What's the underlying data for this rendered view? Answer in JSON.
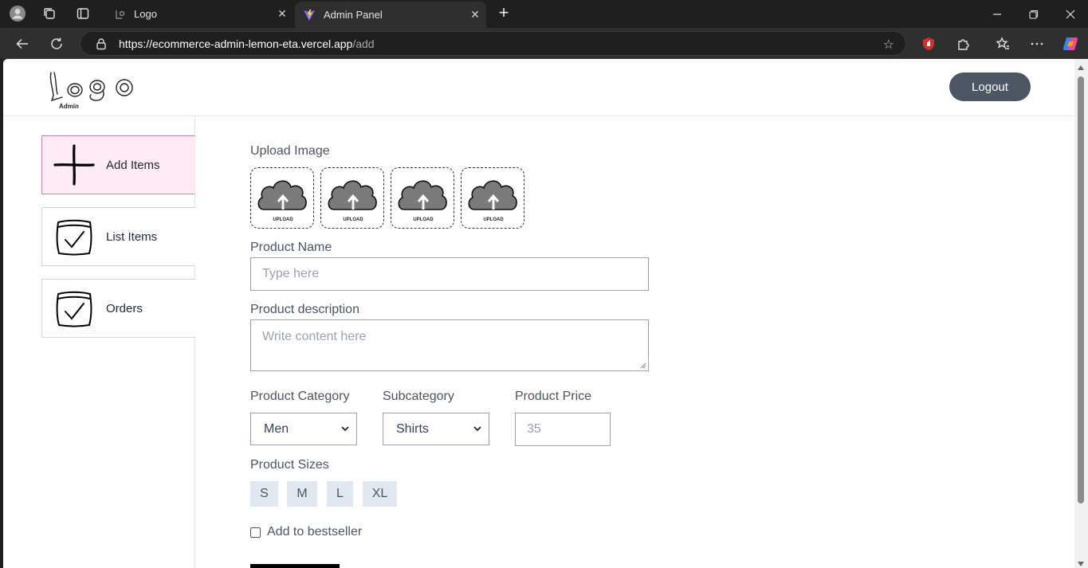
{
  "browser": {
    "tabs": [
      {
        "title": "Logo",
        "active": false
      },
      {
        "title": "Admin Panel",
        "active": true
      }
    ],
    "url": {
      "host": "https://ecommerce-admin-lemon-eta.vercel.app",
      "path": "/add"
    }
  },
  "header": {
    "logo_text": "Logo",
    "logo_subtext": "Admin",
    "logout_label": "Logout"
  },
  "sidebar": {
    "items": [
      {
        "label": "Add Items",
        "icon": "plus-icon",
        "active": true
      },
      {
        "label": "List Items",
        "icon": "checklist-icon",
        "active": false
      },
      {
        "label": "Orders",
        "icon": "checklist-icon",
        "active": false
      }
    ]
  },
  "form": {
    "upload_label": "Upload Image",
    "upload_box_text": "UPLOAD",
    "name_label": "Product Name",
    "name_placeholder": "Type here",
    "description_label": "Product description",
    "description_placeholder": "Write content here",
    "category_label": "Product Category",
    "category_value": "Men",
    "subcategory_label": "Subcategory",
    "subcategory_value": "Shirts",
    "price_label": "Product Price",
    "price_placeholder": "35",
    "sizes_label": "Product Sizes",
    "sizes": [
      "S",
      "M",
      "L",
      "XL"
    ],
    "bestseller_label": "Add to bestseller"
  },
  "colors": {
    "active_item_bg": "#ffebf5",
    "logout_bg": "#4b5563",
    "size_chip_bg": "#e2e8f0"
  }
}
